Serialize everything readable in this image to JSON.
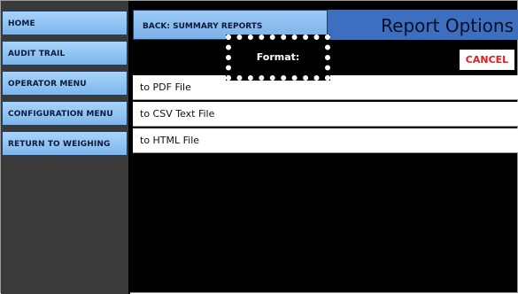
{
  "sidebar": {
    "items": [
      {
        "label": "HOME"
      },
      {
        "label": "AUDIT TRAIL"
      },
      {
        "label": "OPERATOR MENU"
      },
      {
        "label": "CONFIGURATION MENU"
      },
      {
        "label": "RETURN TO WEIGHING"
      }
    ]
  },
  "header": {
    "back_label": "BACK: SUMMARY REPORTS",
    "title": "Report Options",
    "cancel_label": "CANCEL"
  },
  "format": {
    "label": "Format:"
  },
  "options": [
    {
      "label": "to PDF File"
    },
    {
      "label": "to CSV Text File"
    },
    {
      "label": "to HTML File"
    }
  ],
  "colors": {
    "button_blue": "#8fc3f3",
    "title_blue": "#3c6fc0",
    "cancel_red": "#e11d1d",
    "background": "#000000"
  }
}
